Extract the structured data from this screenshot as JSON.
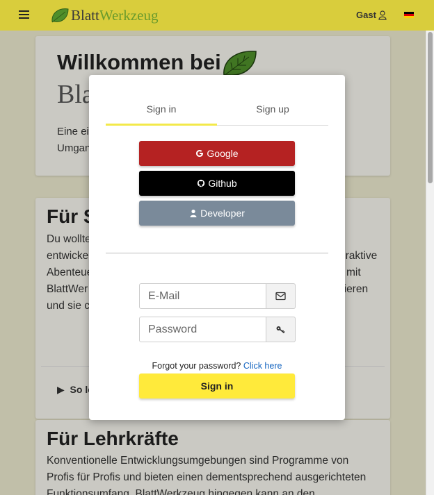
{
  "navbar": {
    "brand_part1": "Blatt",
    "brand_part2": "Werkzeug",
    "user_label": "Gast",
    "language_flag": "de-flag-icon"
  },
  "welcome": {
    "title": "Willkommen bei",
    "brand": "BlattWerkzeug",
    "description_line1": "Eine ei",
    "description_line2": "Umgan"
  },
  "students": {
    "heading": "Für S",
    "lines": [
      "Du wollte",
      "entwicke",
      "Abenteue",
      "BlattWer",
      "und sie c"
    ],
    "right_fragments": [
      "eraktive",
      "mit",
      "nieren"
    ],
    "details_label": "So le"
  },
  "teachers": {
    "heading": "Für Lehrkräfte",
    "paragraph": "Konventionelle Entwicklungsumgebungen sind Programme von Profis für Profis und bieten einen dementsprechend ausgerichteten Funktionsumfang. BlattWerkzeug hingegen kann an den"
  },
  "modal": {
    "tabs": [
      {
        "label": "Sign in",
        "active": true
      },
      {
        "label": "Sign up",
        "active": false
      }
    ],
    "buttons": {
      "google": "Google",
      "github": "Github",
      "developer": "Developer"
    },
    "email_placeholder": "E-Mail",
    "password_placeholder": "Password",
    "forgot_text": "Forgot your password?",
    "forgot_link": "Click here",
    "signin_label": "Sign in"
  },
  "colors": {
    "navbar": "#d9cd3c",
    "google": "#b52222",
    "github": "#000000",
    "developer": "#7a8a9a",
    "signin": "#ffea3b",
    "active_tab": "#f3e94a"
  }
}
